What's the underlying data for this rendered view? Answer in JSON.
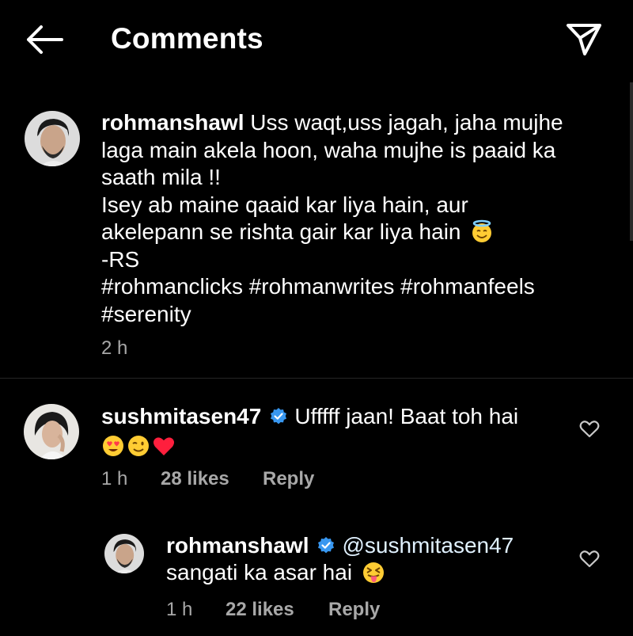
{
  "header": {
    "title": "Comments",
    "back_icon": "arrow-left-icon",
    "share_icon": "paper-plane-icon"
  },
  "caption": {
    "username": "rohmanshawl",
    "lines": [
      "Uss waqt,uss jagah, jaha mujhe",
      "laga main akela hoon, waha mujhe is paaid ka",
      "saath mila !!",
      "Isey ab maine qaaid kar liya hain, aur",
      "akelepann se rishta gair kar liya hain",
      "-RS",
      "#rohmanclicks #rohmanwrites #rohmanfeels",
      "#serenity"
    ],
    "time": "2 h",
    "emoji": "smiling-face-with-halo"
  },
  "comments": [
    {
      "username": "sushmitasen47",
      "verified": true,
      "text": "Ufffff jaan! Baat toh hai",
      "emojis": [
        "heart-eyes-emoji",
        "wink-emoji",
        "red-heart-emoji"
      ],
      "time": "1 h",
      "likes": "28 likes",
      "reply_label": "Reply",
      "like_icon": "heart-outline-icon"
    }
  ],
  "replies": [
    {
      "username": "rohmanshawl",
      "verified": true,
      "mention": "@sushmitasen47",
      "text": "sangati ka asar hai",
      "emoji": "squinting-tongue-emoji",
      "time": "1 h",
      "likes": "22 likes",
      "reply_label": "Reply",
      "like_icon": "heart-outline-icon"
    }
  ],
  "colors": {
    "background": "#000000",
    "text": "#ffffff",
    "secondary": "#a8a8a8",
    "verified": "#3897f0"
  }
}
